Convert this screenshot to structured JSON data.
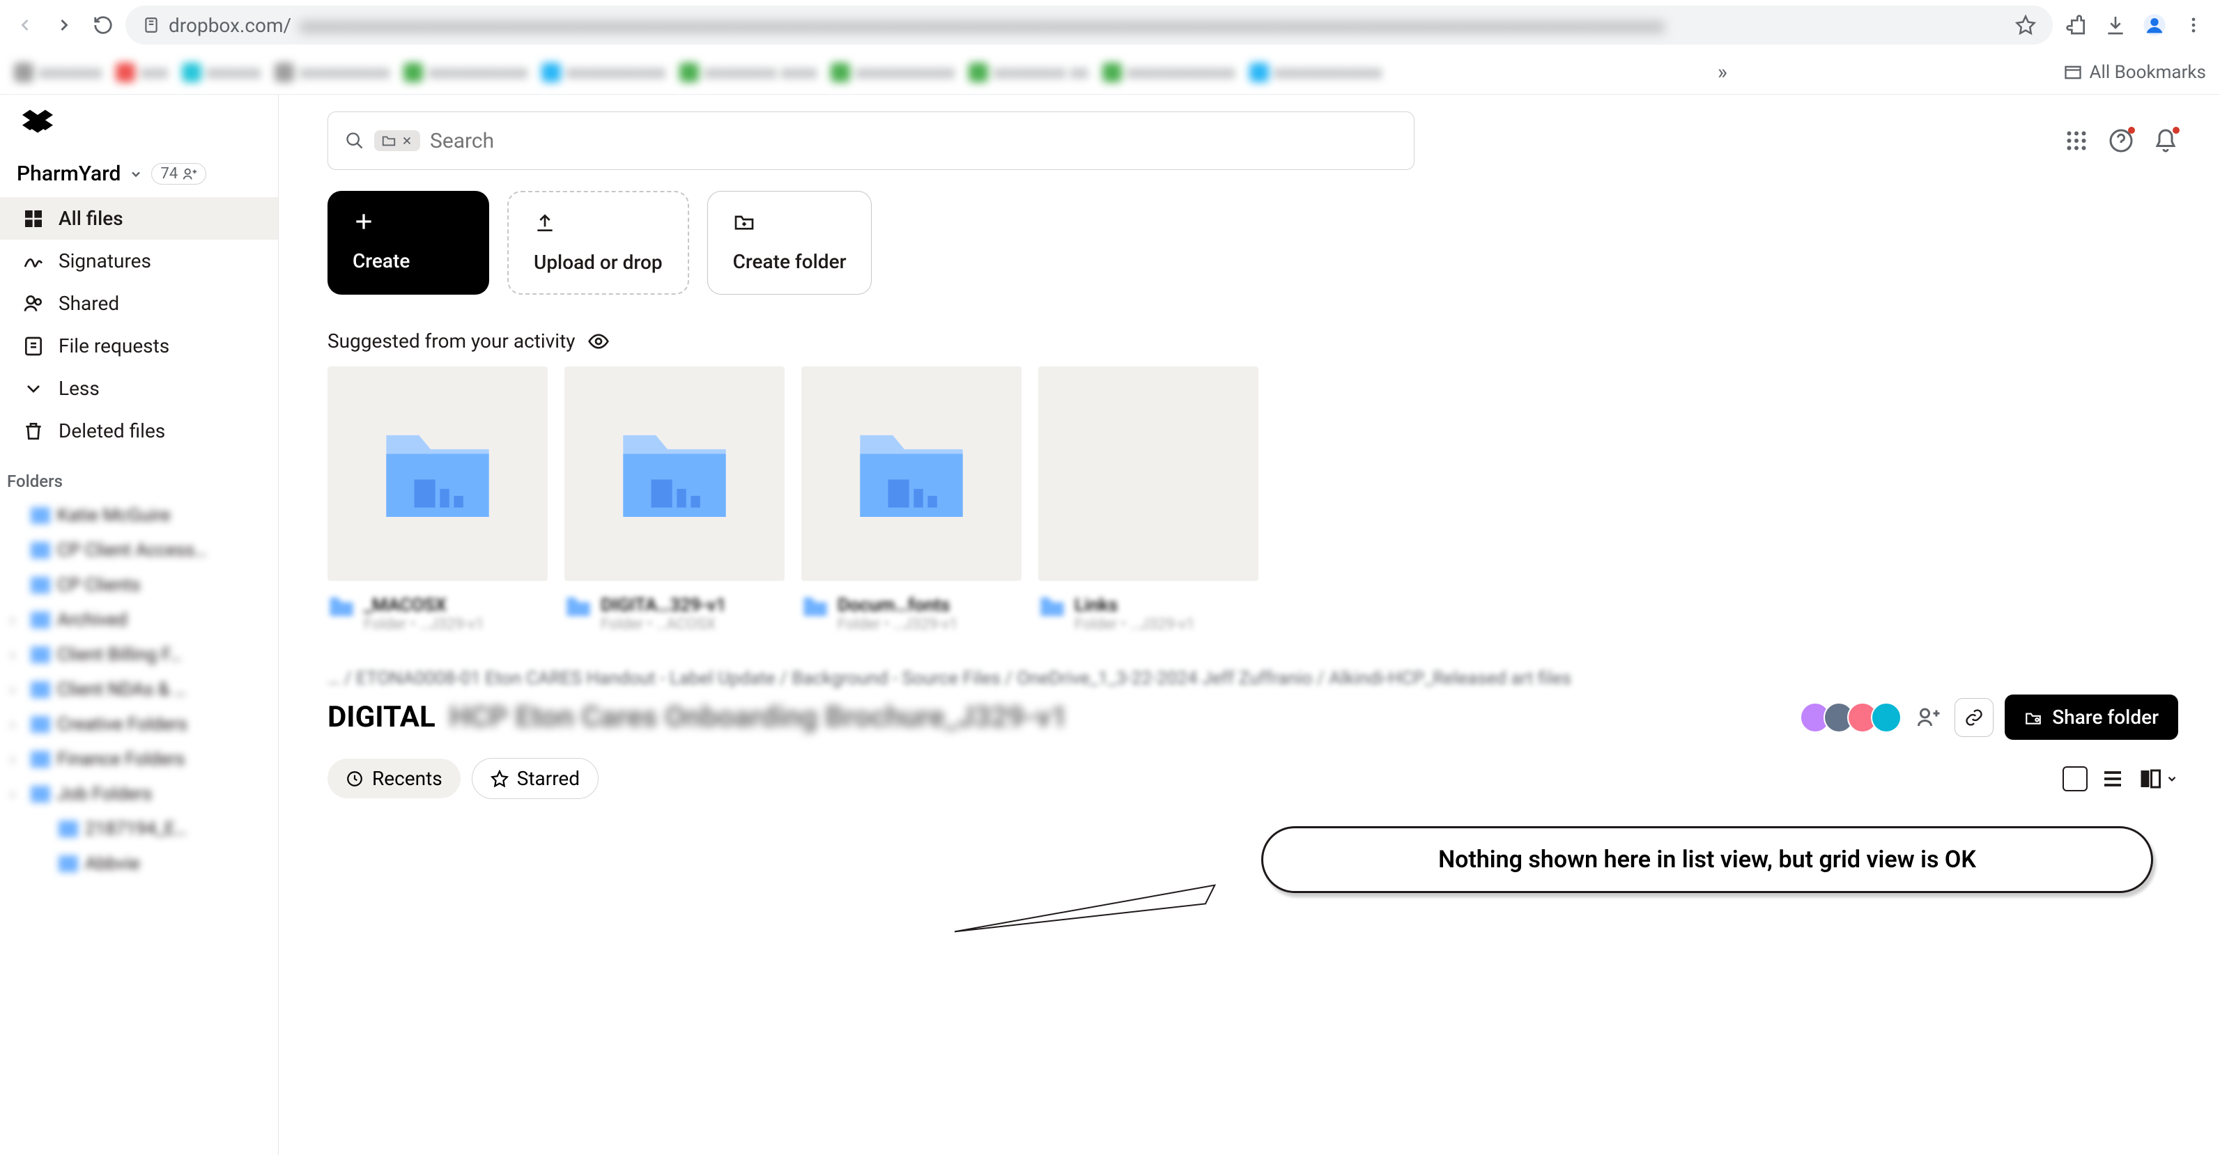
{
  "browser": {
    "url_host": "dropbox.com/",
    "all_bookmarks_label": "All Bookmarks"
  },
  "sidebar": {
    "team_name": "PharmYard",
    "team_count": "74",
    "nav": {
      "all_files": "All files",
      "signatures": "Signatures",
      "shared": "Shared",
      "file_requests": "File requests",
      "less": "Less",
      "deleted_files": "Deleted files"
    },
    "folders_label": "Folders",
    "folder_items": [
      "Katie McGuire",
      "CP Client Access…",
      "CP Clients",
      "Archived",
      "Client Billing F…",
      "Client NDAs & …",
      "Creative Folders",
      "Finance Folders",
      "Job Folders",
      "2187194_E…",
      "Abbvie"
    ]
  },
  "search": {
    "placeholder": "Search"
  },
  "actions": {
    "create": "Create",
    "upload": "Upload or drop",
    "create_folder": "Create folder"
  },
  "suggested_label": "Suggested from your activity",
  "suggested": [
    {
      "name": "_MACOSX",
      "sub": "Folder • …J329-v1"
    },
    {
      "name": "DIGITA…329-v1",
      "sub": "Folder • …ACOSX"
    },
    {
      "name": "Docum…fonts",
      "sub": "Folder • …J329-v1"
    },
    {
      "name": "Links",
      "sub": "Folder • …J329-v1"
    }
  ],
  "breadcrumb": "…  /  ETONA0008-01 Eton CARES Handout - Label Update  /  Background - Source Files  /  OneDrive_1_3-22-2024 Jeff Zuffranio  /  Alkindi-HCP_Released art files",
  "folder_title_prefix": "DIGITAL",
  "folder_title_rest": "HCP Eton Cares Onboarding Brochure_J329-v1",
  "filters": {
    "recents": "Recents",
    "starred": "Starred"
  },
  "share_label": "Share folder",
  "avatars": [
    "#c084fc",
    "#64748b",
    "#fb7185",
    "#06b6d4"
  ],
  "callout_text": "Nothing shown here in list view, but grid view is OK"
}
